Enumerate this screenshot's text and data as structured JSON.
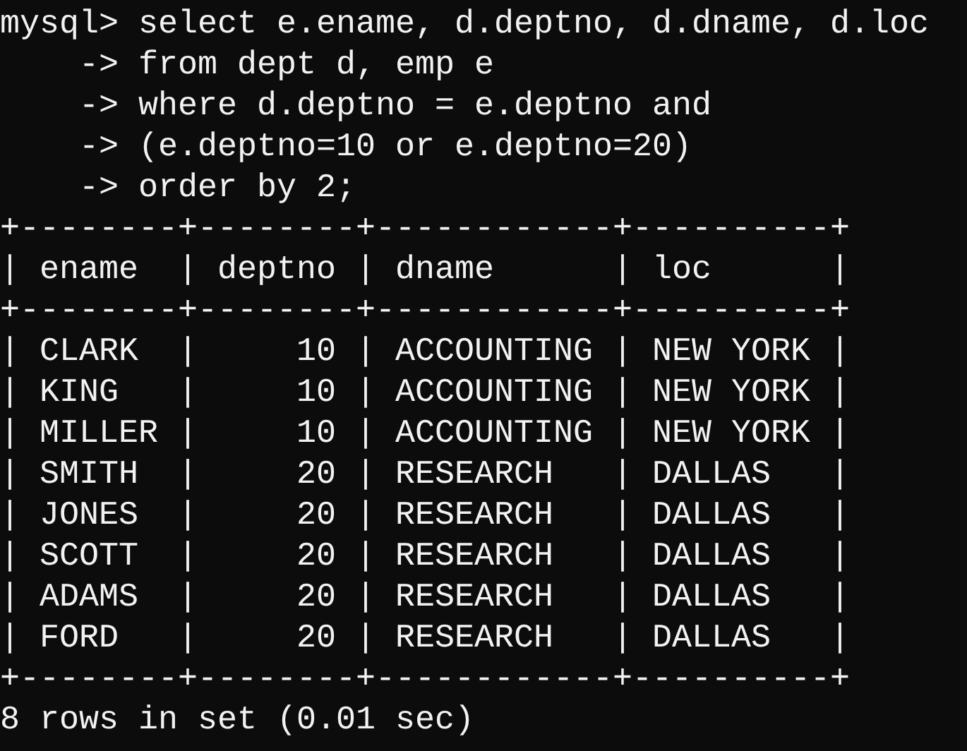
{
  "lines": [
    {
      "kind": "command",
      "prompt": "mysql>",
      "text": "select e.ename, d.deptno, d.dname, d.loc"
    },
    {
      "kind": "command",
      "prompt": "    ->",
      "text": "from dept d, emp e"
    },
    {
      "kind": "command",
      "prompt": "    ->",
      "text": "where d.deptno = e.deptno and"
    },
    {
      "kind": "command",
      "prompt": "    ->",
      "text": "(e.deptno=10 or e.deptno=20)"
    },
    {
      "kind": "command",
      "prompt": "    ->",
      "text": "order by 2;"
    },
    {
      "kind": "border",
      "text": "+--------+--------+------------+----------+"
    },
    {
      "kind": "row",
      "text": "| ename  | deptno | dname      | loc      |"
    },
    {
      "kind": "border",
      "text": "+--------+--------+------------+----------+"
    },
    {
      "kind": "row",
      "text": "| CLARK  |     10 | ACCOUNTING | NEW YORK |"
    },
    {
      "kind": "row",
      "text": "| KING   |     10 | ACCOUNTING | NEW YORK |"
    },
    {
      "kind": "row",
      "text": "| MILLER |     10 | ACCOUNTING | NEW YORK |"
    },
    {
      "kind": "row",
      "text": "| SMITH  |     20 | RESEARCH   | DALLAS   |"
    },
    {
      "kind": "row",
      "text": "| JONES  |     20 | RESEARCH   | DALLAS   |"
    },
    {
      "kind": "row",
      "text": "| SCOTT  |     20 | RESEARCH   | DALLAS   |"
    },
    {
      "kind": "row",
      "text": "| ADAMS  |     20 | RESEARCH   | DALLAS   |"
    },
    {
      "kind": "row",
      "text": "| FORD   |     20 | RESEARCH   | DALLAS   |"
    },
    {
      "kind": "border",
      "text": "+--------+--------+------------+----------+"
    },
    {
      "kind": "status",
      "text": "8 rows in set (0.01 sec)"
    }
  ]
}
